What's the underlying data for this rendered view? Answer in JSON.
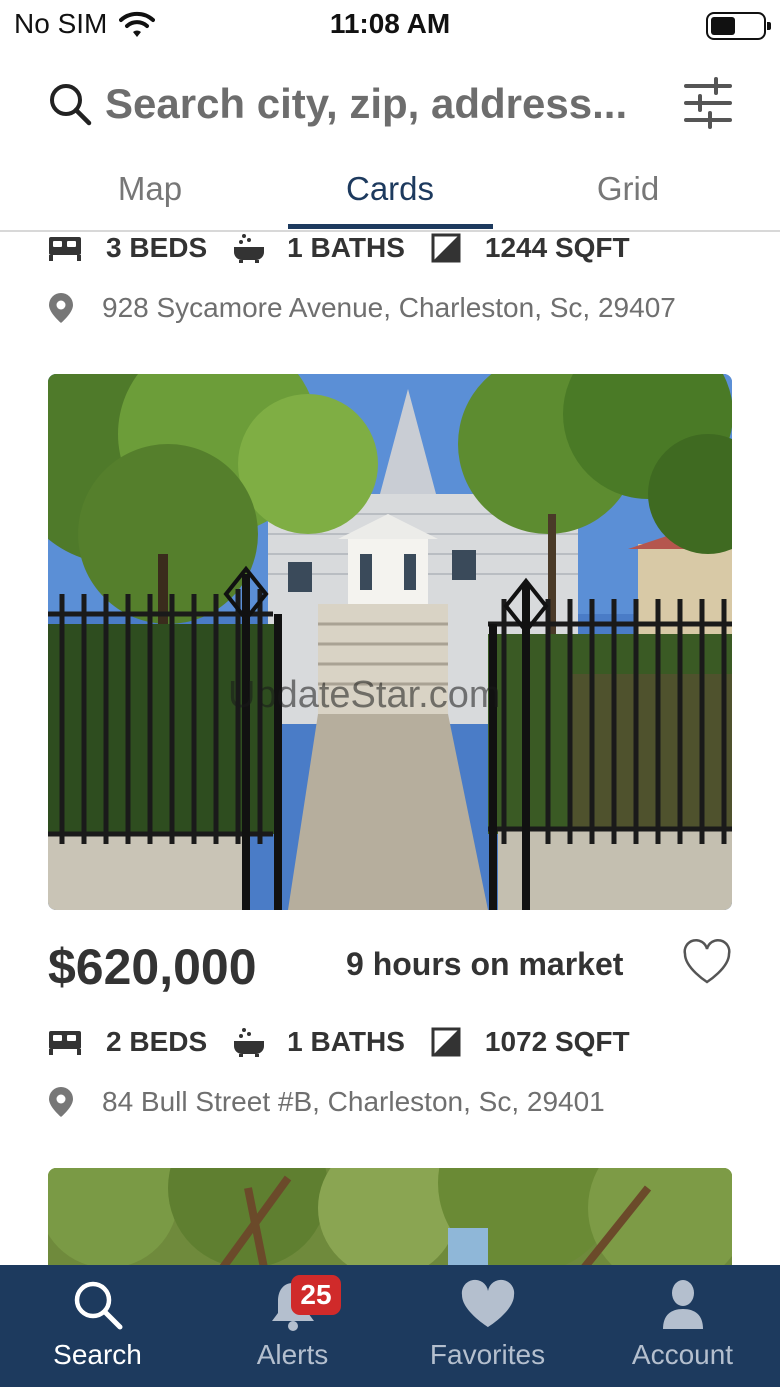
{
  "status_bar": {
    "carrier": "No SIM",
    "time": "11:08 AM",
    "battery_level": 0.45
  },
  "search": {
    "placeholder": "Search city, zip, address..."
  },
  "tabs": [
    {
      "label": "Map",
      "active": false
    },
    {
      "label": "Cards",
      "active": true
    },
    {
      "label": "Grid",
      "active": false
    }
  ],
  "listings": [
    {
      "beds": "3 BEDS",
      "baths": "1 BATHS",
      "sqft": "1244 SQFT",
      "address": "928 Sycamore Avenue, Charleston, Sc, 29407"
    },
    {
      "photo_watermark": "UpdateStar.com",
      "price": "$620,000",
      "market_time": "9 hours on market",
      "beds": "2 BEDS",
      "baths": "1 BATHS",
      "sqft": "1072 SQFT",
      "address": "84 Bull Street #B, Charleston, Sc, 29401"
    }
  ],
  "bottom_nav": [
    {
      "label": "Search",
      "icon": "search-icon",
      "active": true
    },
    {
      "label": "Alerts",
      "icon": "bell-icon",
      "badge": "25",
      "active": false
    },
    {
      "label": "Favorites",
      "icon": "heart-icon",
      "active": false
    },
    {
      "label": "Account",
      "icon": "person-icon",
      "active": false
    }
  ],
  "colors": {
    "brand": "#1d3a5e",
    "badge": "#d02a2a",
    "text": "#333333",
    "muted": "#6f6f6f"
  }
}
